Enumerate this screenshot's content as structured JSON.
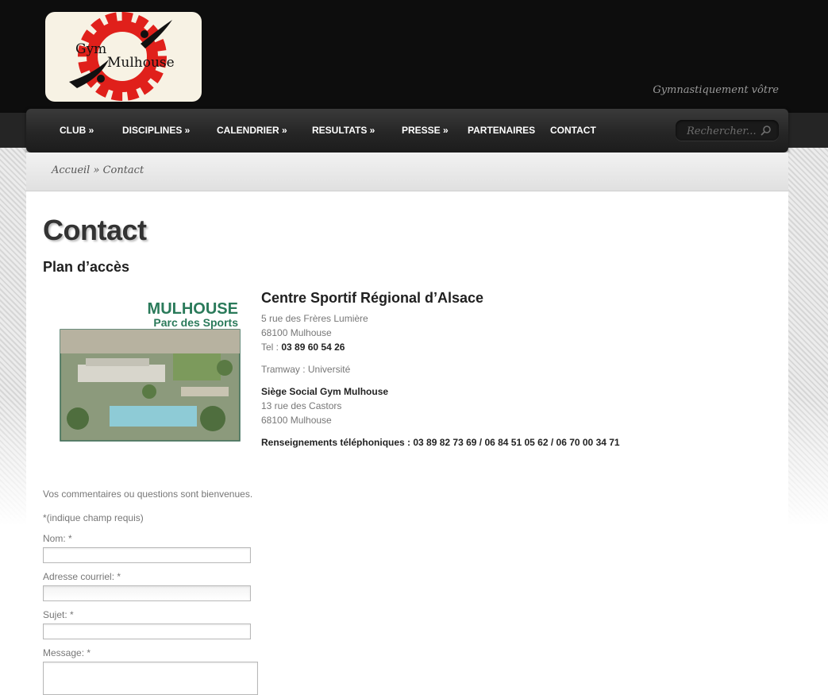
{
  "header": {
    "logo_text_line1": "Gym",
    "logo_text_line2": "Mulhouse",
    "tagline": "Gymnastiquement vôtre"
  },
  "nav": {
    "items": [
      {
        "label": "CLUB »"
      },
      {
        "label": "DISCIPLINES »"
      },
      {
        "label": "CALENDRIER »"
      },
      {
        "label": "RESULTATS »"
      },
      {
        "label": "PRESSE »"
      },
      {
        "label": "PARTENAIRES"
      },
      {
        "label": "CONTACT"
      }
    ],
    "search_placeholder": "Rechercher...",
    "search_icon": "search-icon"
  },
  "breadcrumb": {
    "home": "Accueil",
    "separator": " » ",
    "current": "Contact"
  },
  "page": {
    "title": "Contact",
    "section_title": "Plan d’accès"
  },
  "map_image": {
    "title_line1": "MULHOUSE",
    "title_line2": "Parc des Sports"
  },
  "venue": {
    "name": "Centre Sportif Régional d’Alsace",
    "address_line1": "5 rue des Frères Lumière",
    "address_line2": "68100 Mulhouse",
    "tel_label": "Tel : ",
    "tel_value": "03 89 60 54 26",
    "tram": "Tramway : Université"
  },
  "siege": {
    "title": "Siège Social Gym Mulhouse",
    "address_line1": "13 rue des Castors",
    "address_line2": "68100 Mulhouse",
    "phone_line": "Renseignements téléphoniques : 03 89 82 73 69 / 06 84 51 05 62 / 06 70 00 34 71"
  },
  "form": {
    "intro": "Vos commentaires ou questions sont bienvenues.",
    "required_note": "*(indique champ requis)",
    "name_label": "Nom: *",
    "email_label": "Adresse courriel: *",
    "subject_label": "Sujet: *",
    "message_label": "Message: *",
    "name_value": "",
    "email_value": "",
    "subject_value": "",
    "message_value": ""
  },
  "colors": {
    "header_bg": "#0d0d0d",
    "nav_text": "#ffffff",
    "title_text": "#333333",
    "muted_text": "#777777",
    "logo_red": "#e0201b",
    "mulhouse_green": "#2a7a5a"
  }
}
